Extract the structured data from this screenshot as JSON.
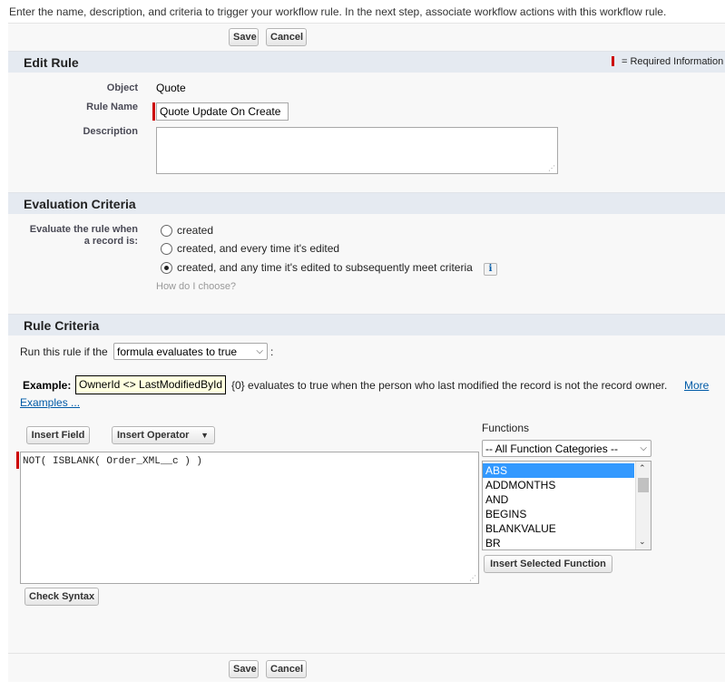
{
  "intro_text": "Enter the name, description, and criteria to trigger your workflow rule. In the next step, associate workflow actions with this workflow rule.",
  "buttons": {
    "save": "Save",
    "cancel": "Cancel"
  },
  "edit_rule": {
    "title": "Edit Rule",
    "required_info": "= Required Information",
    "object_label": "Object",
    "object_value": "Quote",
    "rule_name_label": "Rule Name",
    "rule_name_value": "Quote Update On Create",
    "description_label": "Description",
    "description_value": ""
  },
  "evaluation": {
    "title": "Evaluation Criteria",
    "label_line1": "Evaluate the rule when",
    "label_line2": "a record is:",
    "options": [
      {
        "label": "created",
        "checked": false
      },
      {
        "label": "created, and every time it's edited",
        "checked": false
      },
      {
        "label": "created, and any time it's edited to subsequently meet criteria",
        "checked": true
      }
    ],
    "help_link": "How do I choose?",
    "info_icon": "i"
  },
  "rule_criteria": {
    "title": "Rule Criteria",
    "run_prefix": "Run this rule if the",
    "run_select": "formula evaluates to true",
    "run_suffix": ":",
    "example_label": "Example:",
    "example_formula": "OwnerId <> LastModifiedById",
    "example_desc": "{0} evaluates to true when the person who last modified the record is not the record owner.",
    "more_examples_part1": "More",
    "more_examples_part2": "Examples ...",
    "insert_field": "Insert Field",
    "insert_operator": "Insert Operator",
    "formula_text": "NOT( ISBLANK( Order_XML__c ) )",
    "check_syntax": "Check Syntax",
    "functions_label": "Functions",
    "function_category": "-- All Function Categories --",
    "functions": [
      "ABS",
      "ADDMONTHS",
      "AND",
      "BEGINS",
      "BLANKVALUE",
      "BR"
    ],
    "insert_selected_function": "Insert Selected Function"
  },
  "colors": {
    "required": "#cc0000",
    "section_bg": "#e5eaf1",
    "selected": "#3399ff",
    "link": "#015ba7"
  }
}
